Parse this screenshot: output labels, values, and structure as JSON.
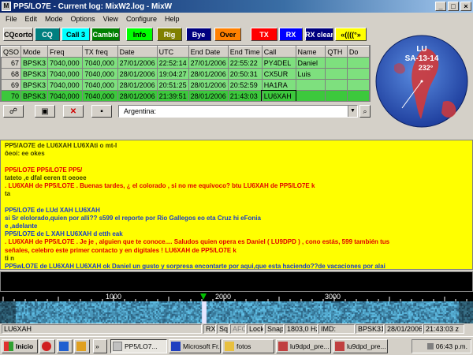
{
  "window": {
    "title": "PP5/LO7E - Current log: MixW2.log - MixW",
    "app_icon": "M"
  },
  "menu": [
    "File",
    "Edit",
    "Mode",
    "Options",
    "View",
    "Configure",
    "Help"
  ],
  "buttons": [
    {
      "label": "CQcorto",
      "bg": "#d4d0c8",
      "fg": "#000000"
    },
    {
      "label": "CQ",
      "bg": "#008080",
      "fg": "#ffffff"
    },
    {
      "label": "Call 3",
      "bg": "#00ffff",
      "fg": "#000000"
    },
    {
      "label": "Cambio",
      "bg": "#008000",
      "fg": "#ffffff"
    },
    {
      "label": "Info",
      "bg": "#00ff00",
      "fg": "#000000"
    },
    {
      "label": "Rig",
      "bg": "#808000",
      "fg": "#ffffff"
    },
    {
      "label": "Bye",
      "bg": "#000080",
      "fg": "#ffffff"
    },
    {
      "label": "Over",
      "bg": "#ff8000",
      "fg": "#000000"
    },
    {
      "label": "TX",
      "bg": "#ff0000",
      "fg": "#ffffff"
    },
    {
      "label": "RX",
      "bg": "#0000ff",
      "fg": "#ffffff"
    },
    {
      "label": "RX clear",
      "bg": "#000080",
      "fg": "#ffffff"
    },
    {
      "label": "«((((°»",
      "bg": "#ffff00",
      "fg": "#000000"
    }
  ],
  "log": {
    "columns": [
      "QSO",
      "Mode",
      "Freq",
      "TX freq",
      "Date",
      "UTC",
      "End Date",
      "End Time",
      "Call",
      "Name",
      "QTH",
      "Do"
    ],
    "rows": [
      [
        "67",
        "BPSK3",
        "7040,000",
        "7040,000",
        "27/01/2006",
        "22:52:14",
        "27/01/2006",
        "22:55:22",
        "PY4DEL",
        "Daniel",
        "",
        ""
      ],
      [
        "68",
        "BPSK3",
        "7040,000",
        "7040,000",
        "28/01/2006",
        "19:04:27",
        "28/01/2006",
        "20:50:31",
        "CX5UR",
        "Luis",
        "",
        ""
      ],
      [
        "69",
        "BPSK3",
        "7040,000",
        "7040,000",
        "28/01/2006",
        "20:51:25",
        "28/01/2006",
        "20:52:59",
        "HA1RA",
        "",
        "",
        ""
      ],
      [
        "70",
        "BPSK3",
        "7040,000",
        "7040,000",
        "28/01/2006",
        "21:39:51",
        "28/01/2006",
        "21:43:03",
        "LU6XAH",
        "",
        "",
        ""
      ]
    ]
  },
  "globe": {
    "prefix": "LU",
    "zone": "SA-13-14",
    "bearing": "232°"
  },
  "toolbar": {
    "country": "Argentina:"
  },
  "rx_lines": [
    {
      "text": "PP5/AO7E de LU6XAH  LU6XAti  o mt-I",
      "color": "dark"
    },
    {
      "text": "ôeoi: ee okes",
      "color": "dark"
    },
    {
      "text": "",
      "color": "dark"
    },
    {
      "text": "PP5/LO7E PP5/LO7E PP5/",
      "color": "red"
    },
    {
      "text": "  tateto ,e    dfal eeren tt oeoee",
      "color": "dark"
    },
    {
      "text": ". LU6XAH de PP5/LO7E .   Buenas tardes,   ¿ el colorado , si no me equivoco?   btu LU6XAH de PP5/LO7E k",
      "color": "red"
    },
    {
      "text": "  ta",
      "color": "dark"
    },
    {
      "text": "",
      "color": "dark"
    },
    {
      "text": " PP5/LO7E de LUd XAH  LU6XAH",
      "color": "blue"
    },
    {
      "text": "si Sr elolorado,quien por alli?? s599 el reporte por Rio Gallegos eo eta Cruz hi  eFonia",
      "color": "blue"
    },
    {
      "text": "e ,adelante",
      "color": "blue"
    },
    {
      "text": " PP5/LO7E de L XAH  LU6XAH    d  etth eak",
      "color": "blue"
    },
    {
      "text": ". LU6XAH de PP5/LO7E .   Je je , alguien que te conoce....   Saludos  quien opera es Daniel ( LU9DPD ) , cono estás,   599 también tus",
      "color": "red"
    },
    {
      "text": "señales, celebro este primer contacto y en digitales !   LU6XAH de PP5/LO7E k",
      "color": "red"
    },
    {
      "text": "  ti  n",
      "color": "dark"
    },
    {
      "text": " PP5wLO7E de LU6XAH  LU6XAH  ok Daniel un gusto y sorpresa encontarte por aqui,que esta haciendo??de vacaciones por alai",
      "color": "blue"
    }
  ],
  "waterfall": {
    "scale_labels": [
      "1000",
      "2000",
      "3000"
    ]
  },
  "status": {
    "call": "LU6XAH",
    "rx": "RX",
    "sq": "Sq",
    "afc": "AFC",
    "lock": "Lock",
    "snap": "Snap",
    "freq": "1803,0 Hz",
    "imd": "IMD:",
    "mode": "BPSK31",
    "date": "28/01/2006",
    "time": "21:43:03 z"
  },
  "taskbar": {
    "start": "Inicio",
    "items": [
      "PP5/LO7...",
      "Microsoft Fr...",
      "fotos",
      "lu9dpd_pre...",
      "lu9dpd_pre..."
    ],
    "clock": "06:43 p.m."
  }
}
